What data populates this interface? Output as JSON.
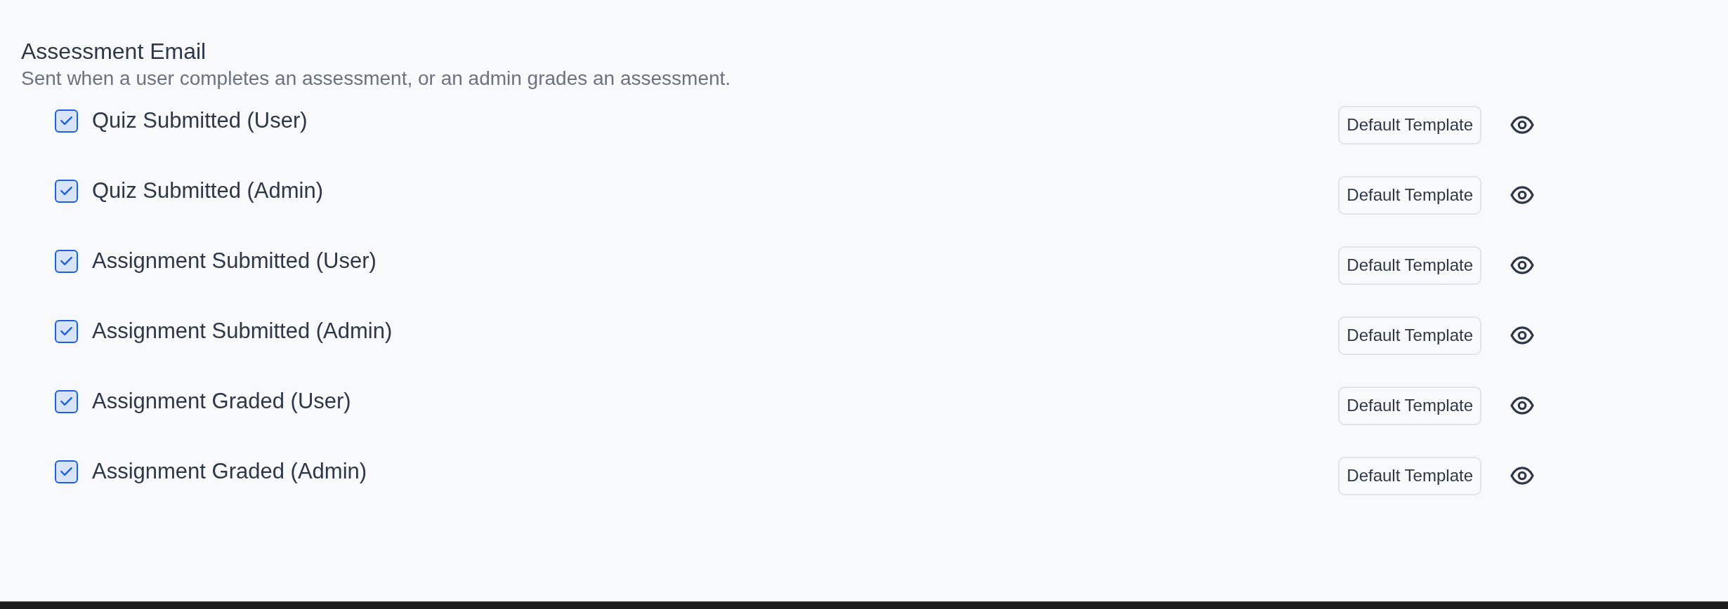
{
  "section": {
    "title": "Assessment Email",
    "description": "Sent when a user completes an assessment, or an admin grades an assessment."
  },
  "emails": [
    {
      "label": "Quiz Submitted (User)",
      "checked": true,
      "template": "Default Template"
    },
    {
      "label": "Quiz Submitted (Admin)",
      "checked": true,
      "template": "Default Template"
    },
    {
      "label": "Assignment Submitted (User)",
      "checked": true,
      "template": "Default Template"
    },
    {
      "label": "Assignment Submitted (Admin)",
      "checked": true,
      "template": "Default Template"
    },
    {
      "label": "Assignment Graded (User)",
      "checked": true,
      "template": "Default Template"
    },
    {
      "label": "Assignment Graded (Admin)",
      "checked": true,
      "template": "Default Template"
    }
  ]
}
